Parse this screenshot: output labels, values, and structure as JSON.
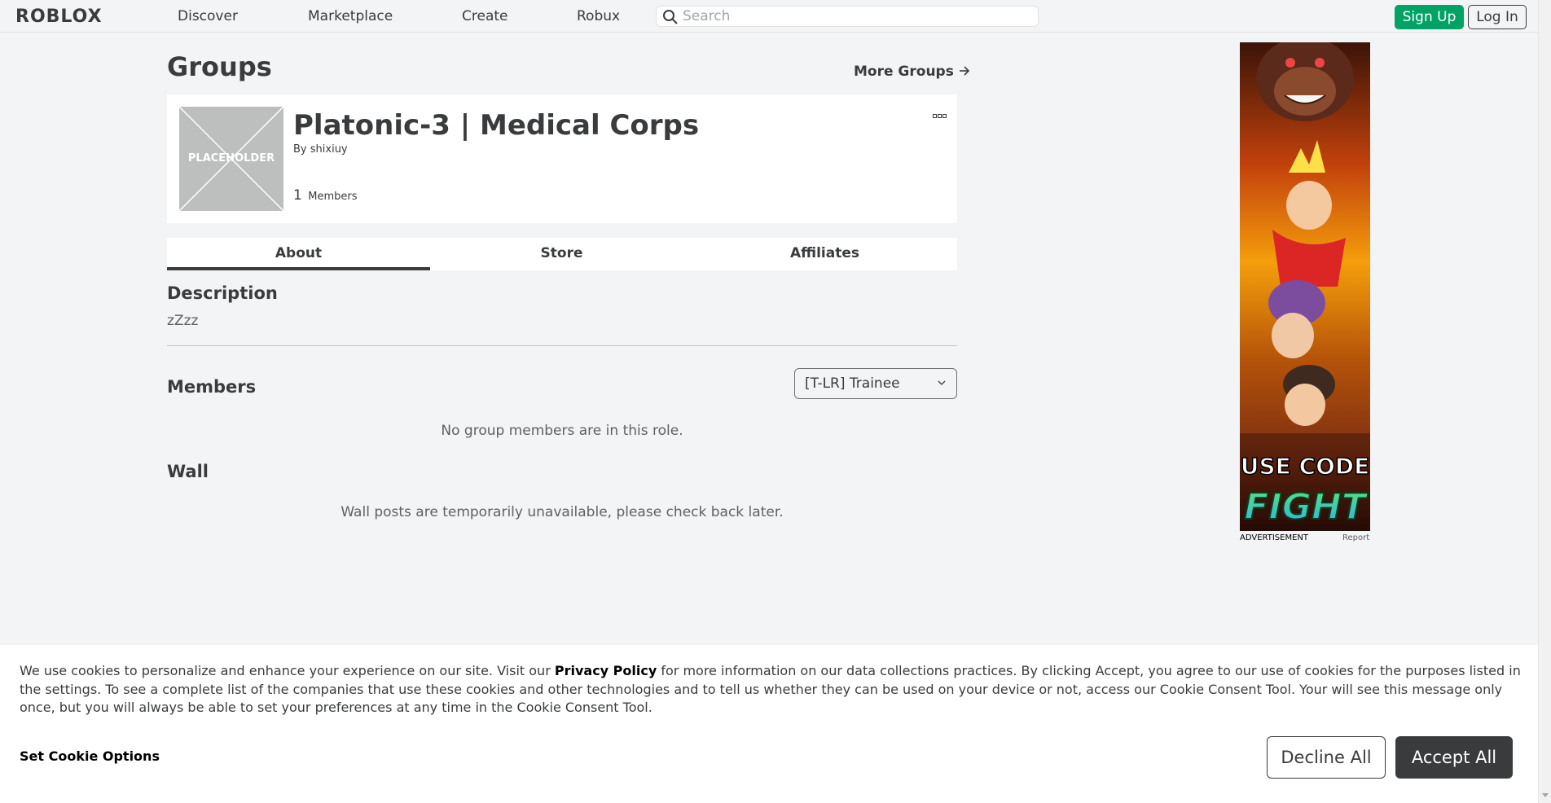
{
  "nav": {
    "logo": "ROBLOX",
    "links": [
      "Discover",
      "Marketplace",
      "Create",
      "Robux"
    ],
    "search_placeholder": "Search",
    "signup_label": "Sign Up",
    "login_label": "Log In"
  },
  "page": {
    "title": "Groups",
    "more_groups": "More Groups"
  },
  "group": {
    "placeholder_text": "PLACEHOLDER",
    "name": "Platonic-3 | Medical Corps",
    "by_label": "By",
    "owner": "shixiuy",
    "member_count": "1",
    "member_label": "Members"
  },
  "tabs": [
    {
      "label": "About",
      "active": true
    },
    {
      "label": "Store",
      "active": false
    },
    {
      "label": "Affiliates",
      "active": false
    }
  ],
  "about": {
    "description_heading": "Description",
    "description_text": "zZzz",
    "members_heading": "Members",
    "role_selected": "[T-LR] Trainee",
    "members_empty": "No group members are in this role.",
    "wall_heading": "Wall",
    "wall_message": "Wall posts are temporarily unavailable, please check back later."
  },
  "ad": {
    "promo_line1": "USE CODE",
    "promo_line2": "FIGHT",
    "label": "ADVERTISEMENT",
    "report": "Report"
  },
  "cookie": {
    "text_before": "We use cookies to personalize and enhance your experience on our site. Visit our ",
    "privacy_link": "Privacy Policy",
    "text_after": " for more information on our data collections practices. By clicking Accept, you agree to our use of cookies for the purposes listed in the settings. To see a complete list of the companies that use these cookies and other technologies and to tell us whether they can be used on your device or not, access our Cookie Consent Tool. Your will see this message only once, but you will always be able to set your preferences at any time in the Cookie Consent Tool.",
    "options_label": "Set Cookie Options",
    "decline_label": "Decline All",
    "accept_label": "Accept All"
  },
  "colors": {
    "signup_green": "#00a266",
    "text_dark": "#393b3d",
    "page_bg": "#f2f4f5"
  }
}
